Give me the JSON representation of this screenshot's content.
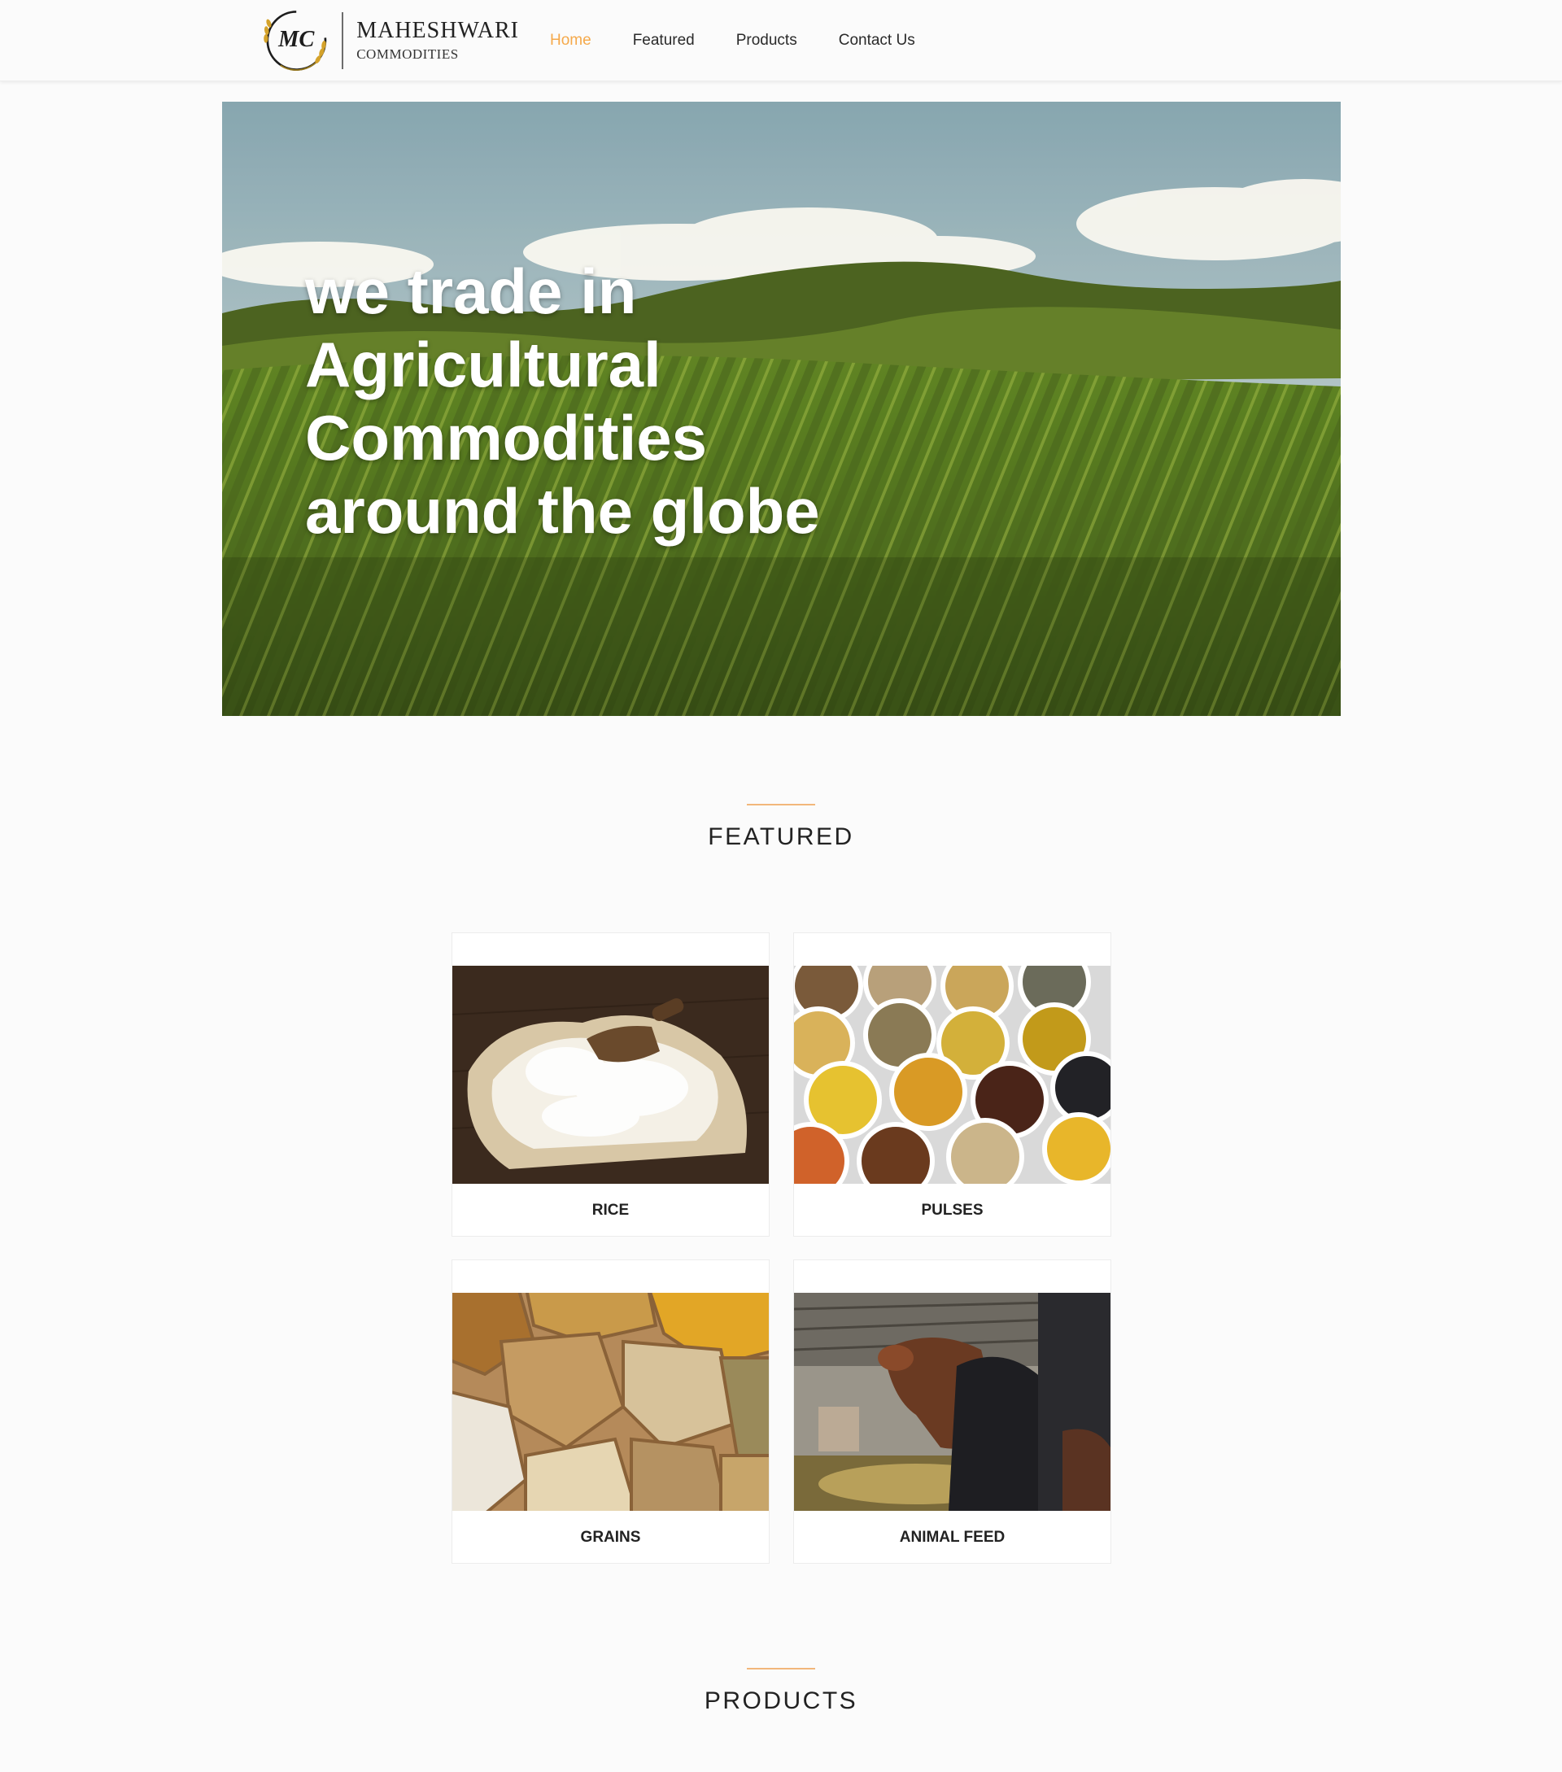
{
  "brand": {
    "initials": "MC",
    "name": "MAHESHWARI",
    "subtitle": "COMMODITIES"
  },
  "nav": {
    "items": [
      {
        "label": "Home",
        "active": true
      },
      {
        "label": "Featured",
        "active": false
      },
      {
        "label": "Products",
        "active": false
      },
      {
        "label": "Contact Us",
        "active": false
      }
    ]
  },
  "hero": {
    "line1": "we trade in",
    "line2": "Agricultural",
    "line3": "Commodities",
    "line4": "around the globe"
  },
  "featured": {
    "title": "FEATURED",
    "items": [
      {
        "label": "RICE"
      },
      {
        "label": "PULSES"
      },
      {
        "label": "GRAINS"
      },
      {
        "label": "ANIMAL FEED"
      }
    ]
  },
  "products": {
    "title": "PRODUCTS"
  },
  "colors": {
    "accent": "#f5a94b",
    "divider": "#f2b77b",
    "logo_gold": "#d4a22a"
  }
}
